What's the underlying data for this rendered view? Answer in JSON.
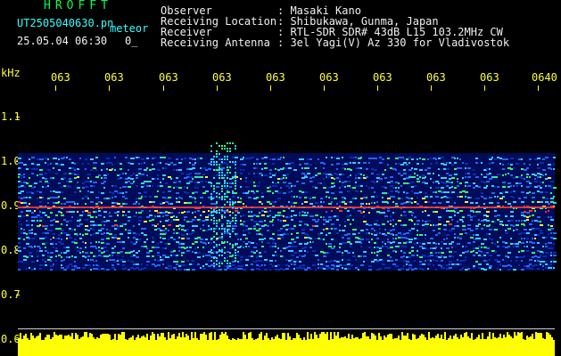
{
  "header": {
    "logo": "HROFFT",
    "filename": "UT2505040630.pn",
    "mode_label": "meteor",
    "datetime": "25.05.04 06:30",
    "count": "0_",
    "fields": [
      {
        "label": "Observer",
        "value": ": Masaki Kano"
      },
      {
        "label": "Receiving Location",
        "value": ": Shibukawa, Gunma, Japan"
      },
      {
        "label": "Receiver",
        "value": ": RTL-SDR SDR# 43dB L15 103.2MHz CW"
      },
      {
        "label": "Receiving Antenna",
        "value": ": 3el Yagi(V) Az 330 for Vladivostok"
      }
    ]
  },
  "axis": {
    "unit": "kHz",
    "time_labels": [
      "063",
      "063",
      "063",
      "063",
      "063",
      "063",
      "063",
      "063",
      "063",
      "0640"
    ],
    "freq_labels": [
      "1.1",
      "1.0",
      "0.9",
      "0.8",
      "0.7",
      "0.6"
    ]
  },
  "colors": {
    "label": "#ffff33",
    "header_text": "#f0f0f0",
    "filename": "#33ffff",
    "logo": "#00ff40"
  }
}
